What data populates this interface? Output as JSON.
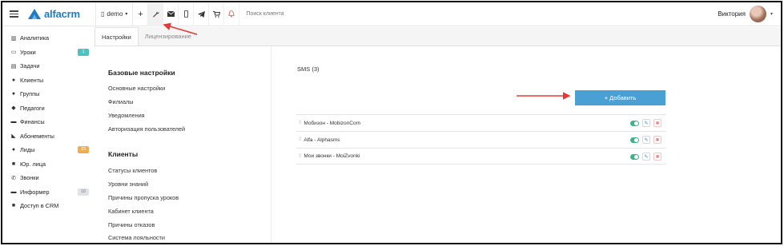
{
  "header": {
    "logo_text": "alfacrm",
    "branch": "demo",
    "search_placeholder": "Поиск клиента",
    "user_name": "Виктория",
    "icons": [
      "plus-icon",
      "wrench-icon",
      "envelope-icon",
      "phone-icon",
      "telegram-icon",
      "cart-icon",
      "bell-icon"
    ]
  },
  "sidebar": {
    "items": [
      {
        "label": "Аналитика",
        "icon": "chart-icon"
      },
      {
        "label": "Уроки",
        "icon": "calendar-icon",
        "badge": "1"
      },
      {
        "label": "Задачи",
        "icon": "tasks-icon"
      },
      {
        "label": "Клиенты",
        "icon": "user-icon"
      },
      {
        "label": "Группы",
        "icon": "users-icon"
      },
      {
        "label": "Педагоги",
        "icon": "graduation-cap-icon"
      },
      {
        "label": "Финансы",
        "icon": "money-icon"
      },
      {
        "label": "Абонементы",
        "icon": "tag-icon"
      },
      {
        "label": "Лиды",
        "icon": "user-plus-icon",
        "badge": "23"
      },
      {
        "label": "Юр. лица",
        "icon": "briefcase-icon"
      },
      {
        "label": "Звонки",
        "icon": "phone-icon"
      },
      {
        "label": "Информер",
        "icon": "credit-card-icon",
        "badge": "10"
      },
      {
        "label": "Доступ в CRM",
        "icon": "lock-icon"
      }
    ]
  },
  "tabs": [
    "Настройки",
    "Лицензирование"
  ],
  "settings_menu": {
    "section1_title": "Базовые настройки",
    "section1_links": [
      "Основные настройки",
      "Филиалы",
      "Уведомления",
      "Авторизация пользователей"
    ],
    "section2_title": "Клиенты",
    "section2_links": [
      "Статусы клиентов",
      "Уровни знаний",
      "Причины пропуска уроков",
      "Кабинет клиента",
      "Причины отказов",
      "Система лояльности"
    ]
  },
  "sms": {
    "title": "SMS (3)",
    "add_button": "+ Добавить",
    "providers": [
      "Мобизон - MobizonCom",
      "Alfa - Alphasms",
      "Мои звонки - MoiZvonki"
    ]
  },
  "colors": {
    "accent": "#4aa0d5",
    "toggle_on": "#3cb38f",
    "annotation_arrow": "#e53935"
  }
}
